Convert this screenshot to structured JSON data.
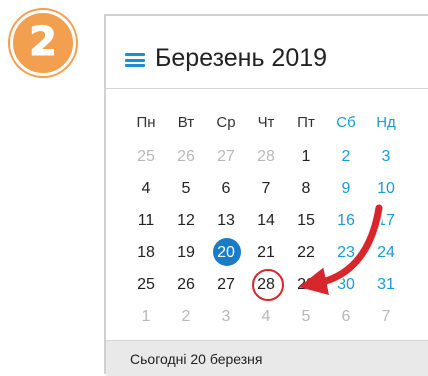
{
  "step_badge": {
    "number": "2",
    "color": "#f2a04f"
  },
  "calendar": {
    "menu_icon": "hamburger-menu-icon",
    "title": "Березень 2019",
    "weekdays": [
      "Пн",
      "Вт",
      "Ср",
      "Чт",
      "Пт",
      "Сб",
      "Нд"
    ],
    "weeks": [
      [
        "25",
        "26",
        "27",
        "28",
        "1",
        "2",
        "3"
      ],
      [
        "4",
        "5",
        "6",
        "7",
        "8",
        "9",
        "10"
      ],
      [
        "11",
        "12",
        "13",
        "14",
        "15",
        "16",
        "17"
      ],
      [
        "18",
        "19",
        "20",
        "21",
        "22",
        "23",
        "24"
      ],
      [
        "25",
        "26",
        "27",
        "28",
        "29",
        "30",
        "31"
      ],
      [
        "1",
        "2",
        "3",
        "4",
        "5",
        "6",
        "7"
      ]
    ],
    "today": "20",
    "selected": "28",
    "footer": "Сьогодні 20 березня"
  },
  "colors": {
    "accent": "#1b7cc5",
    "weekend": "#1a9ad6",
    "muted": "#b8b8b8",
    "highlight": "#d8262d",
    "footer_bg": "#e9e9e9"
  },
  "annotation": {
    "icon": "curved-arrow-icon",
    "color": "#d8262d"
  }
}
